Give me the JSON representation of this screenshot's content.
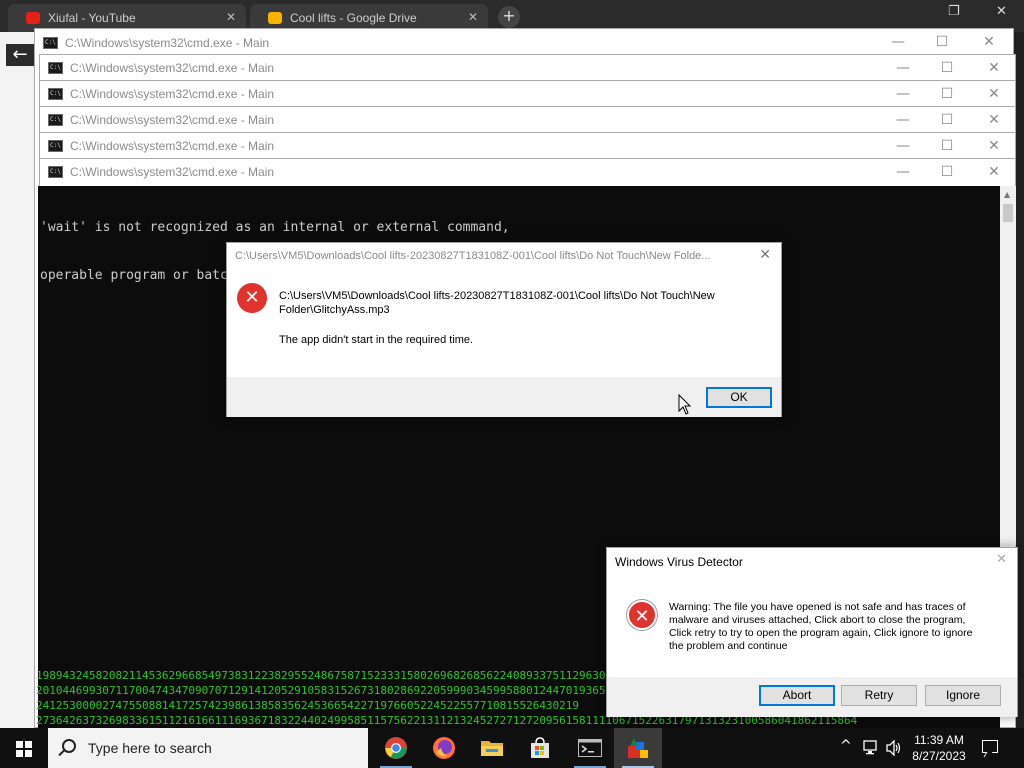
{
  "browser": {
    "tabs": [
      {
        "label": "Xiufal - YouTube"
      },
      {
        "label": "Cool lifts - Google Drive"
      }
    ],
    "new_tab": "+"
  },
  "cmd_windows": [
    {
      "title": "C:\\Windows\\system32\\cmd.exe - Main"
    },
    {
      "title": "C:\\Windows\\system32\\cmd.exe - Main"
    },
    {
      "title": "C:\\Windows\\system32\\cmd.exe - Main"
    },
    {
      "title": "C:\\Windows\\system32\\cmd.exe - Main"
    },
    {
      "title": "C:\\Windows\\system32\\cmd.exe - Main"
    },
    {
      "title": "C:\\Windows\\system32\\cmd.exe - Main"
    }
  ],
  "console": {
    "line1": "'wait' is not recognized as an internal or external command,",
    "line2": "operable program or batch file.",
    "matrix": [
      "1989432458208211453629668549738312238295524867587152333158026968268562240893375112963015826",
      "2010446993071170047434709070712914120529105831526731802869220599903459958801244701936553",
      "2412530000274755088141725742398613858356245366542271976605224522557710815526430219",
      "2736426373269833615112161661116936718322440249958511575622131121324527271272095615811110671522631797131323100586041862115864"
    ]
  },
  "error_dialog": {
    "title": "C:\\Users\\VM5\\Downloads\\Cool lifts-20230827T183108Z-001\\Cool lifts\\Do Not Touch\\New Folde...",
    "message": "C:\\Users\\VM5\\Downloads\\Cool lifts-20230827T183108Z-001\\Cool lifts\\Do Not Touch\\New Folder\\GlitchyAss.mp3",
    "detail": "The app didn't start in the required time.",
    "ok_label": "OK",
    "close": "✕"
  },
  "virus_dialog": {
    "title": "Windows Virus Detector",
    "message": "Warning: The file you have opened is not safe and has traces of malware and viruses attached, Click abort to close the program, Click retry to try to open the program again, Click ignore to ignore the problem and continue",
    "abort_label": "Abort",
    "retry_label": "Retry",
    "ignore_label": "Ignore",
    "close": "✕"
  },
  "taskbar": {
    "search_placeholder": "Type here to search",
    "time": "11:39 AM",
    "date": "8/27/2023"
  },
  "colors": {
    "error_red": "#e0332d",
    "matrix_green": "#2fc22f",
    "accent_blue": "#0078d7"
  }
}
